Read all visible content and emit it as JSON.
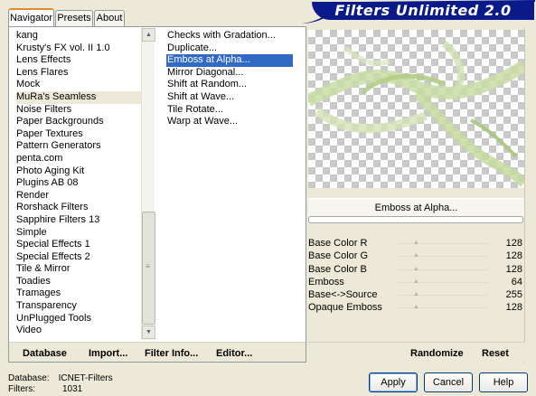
{
  "tabs": [
    "Navigator",
    "Presets",
    "About"
  ],
  "banner_title": "Filters Unlimited 2.0",
  "categories": [
    {
      "label": "kang"
    },
    {
      "label": "Krusty's FX vol. II 1.0"
    },
    {
      "label": "Lens Effects"
    },
    {
      "label": "Lens Flares"
    },
    {
      "label": "Mock"
    },
    {
      "label": "MuRa's Seamless",
      "selected": true
    },
    {
      "label": "Noise Filters"
    },
    {
      "label": "Paper Backgrounds"
    },
    {
      "label": "Paper Textures"
    },
    {
      "label": "Pattern Generators"
    },
    {
      "label": "penta.com"
    },
    {
      "label": "Photo Aging Kit"
    },
    {
      "label": "Plugins AB 08"
    },
    {
      "label": "Render"
    },
    {
      "label": "Rorshack Filters"
    },
    {
      "label": "Sapphire Filters 13"
    },
    {
      "label": "Simple"
    },
    {
      "label": "Special Effects 1"
    },
    {
      "label": "Special Effects 2"
    },
    {
      "label": "Tile & Mirror"
    },
    {
      "label": "Toadies"
    },
    {
      "label": "Tramages"
    },
    {
      "label": "Transparency"
    },
    {
      "label": "UnPlugged Tools"
    },
    {
      "label": "Video"
    }
  ],
  "filters": [
    {
      "label": "Checks with Gradation..."
    },
    {
      "label": "Duplicate..."
    },
    {
      "label": "Emboss at Alpha...",
      "selected": true
    },
    {
      "label": "Mirror Diagonal..."
    },
    {
      "label": "Shift at Random..."
    },
    {
      "label": "Shift at Wave..."
    },
    {
      "label": "Tile Rotate..."
    },
    {
      "label": "Warp at Wave..."
    }
  ],
  "bottom_buttons": {
    "database": "Database",
    "import": "Import...",
    "filter_info": "Filter Info...",
    "editor": "Editor..."
  },
  "selected_filter_title": "Emboss at Alpha...",
  "params": [
    {
      "label": "Base Color R",
      "value": "128"
    },
    {
      "label": "Base Color G",
      "value": "128"
    },
    {
      "label": "Base Color B",
      "value": "128"
    },
    {
      "label": "Emboss",
      "value": "64"
    },
    {
      "label": "Base<->Source",
      "value": "255"
    },
    {
      "label": "Opaque Emboss",
      "value": "128"
    }
  ],
  "randomize_label": "Randomize",
  "reset_label": "Reset",
  "status": {
    "database_label": "Database:",
    "database_value": "ICNET-Filters",
    "filters_label": "Filters:",
    "filters_value": "1031"
  },
  "dialog_buttons": {
    "apply": "Apply",
    "cancel": "Cancel",
    "help": "Help"
  },
  "colors": {
    "banner": "#0a1a8a",
    "selection": "#316ac5",
    "preview_green": "#a9c77a"
  },
  "icons": [
    "scroll-up-arrow-icon",
    "scroll-down-arrow-icon",
    "scrollbar-grip-icon"
  ]
}
